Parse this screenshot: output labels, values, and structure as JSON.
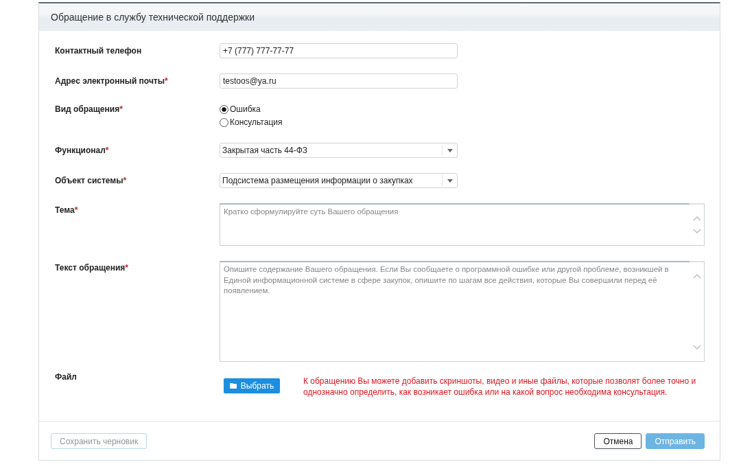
{
  "dialog": {
    "title": "Обращение в службу технической поддержки"
  },
  "fields": [
    {
      "kind": "text",
      "label": "Контактный телефон",
      "value": "+7 (777) 777-77-77"
    },
    {
      "kind": "text",
      "label": "Адрес электронный почты",
      "required_mark": "*",
      "value": "testoos@ya.ru"
    },
    {
      "kind": "radio",
      "label": "Вид обращения",
      "required_mark": "*",
      "options": [
        {
          "label": "Ошибка",
          "selected": true
        },
        {
          "label": "Консультация",
          "selected": false
        }
      ]
    },
    {
      "kind": "select",
      "label": "Функционал",
      "required_mark": "*",
      "value": "Закрытая часть 44-ФЗ"
    },
    {
      "kind": "select",
      "label": "Объект системы",
      "required_mark": "*",
      "value": "Подсистема размещения информации о закупках"
    },
    {
      "kind": "textarea",
      "label": "Тема",
      "required_mark": "*",
      "placeholder": "Кратко сформулируйте суть Вашего обращения"
    },
    {
      "kind": "textarea",
      "label": "Текст обращения",
      "required_mark": "*",
      "placeholder": "Опишите содержание Вашего обращения. Если Вы сообщаете о программной ошибке или другой проблеме, возникшей в Единой информационной системе в сфере закупок, опишите по шагам все действия, которые Вы совершили перед её появлением."
    },
    {
      "kind": "file",
      "label": "Файл",
      "button": "Выбрать",
      "hint": "К обращению Вы можете добавить скриншоты, видео и иные файлы, которые позволят более точно и однозначно определить, как возникает ошибка или на какой вопрос необходима консультация."
    }
  ],
  "footer": {
    "left_buttons": [
      {
        "label": "Сохранить черновик",
        "kind": "secondary",
        "disabled": true
      }
    ],
    "right_buttons": [
      {
        "label": "Отмена",
        "kind": "secondary",
        "disabled": false
      },
      {
        "label": "Отправить",
        "kind": "primary",
        "disabled": true
      }
    ]
  }
}
